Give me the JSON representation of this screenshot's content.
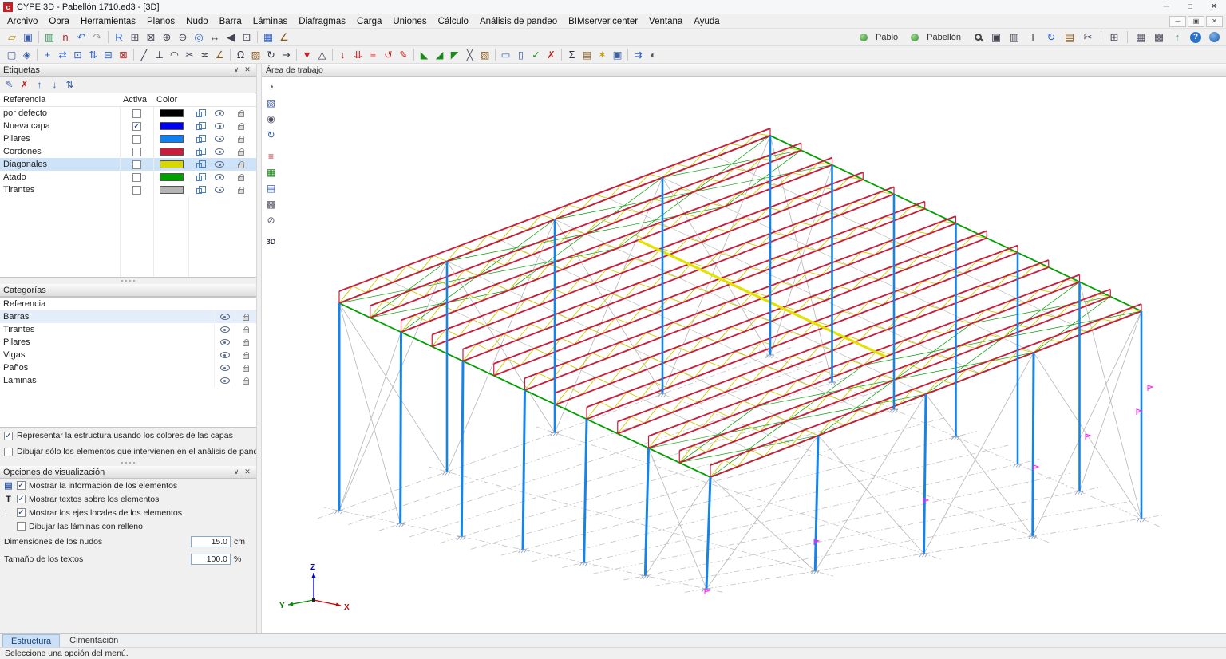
{
  "window": {
    "icon": "c",
    "title": "CYPE 3D - Pabellón 1710.ed3 - [3D]",
    "controls": [
      {
        "name": "minimize-button",
        "glyph": "─"
      },
      {
        "name": "maximize-button",
        "glyph": "□"
      },
      {
        "name": "close-button",
        "glyph": "✕"
      }
    ],
    "child_controls": [
      {
        "name": "child-minimize-button",
        "glyph": "─"
      },
      {
        "name": "child-restore-button",
        "glyph": "▣"
      },
      {
        "name": "child-close-button",
        "glyph": "✕"
      }
    ]
  },
  "menu": [
    "Archivo",
    "Obra",
    "Herramientas",
    "Planos",
    "Nudo",
    "Barra",
    "Láminas",
    "Diafragmas",
    "Carga",
    "Uniones",
    "Cálculo",
    "Análisis de pandeo",
    "BIMserver.center",
    "Ventana",
    "Ayuda"
  ],
  "toolbar_main": [
    {
      "name": "open-job-icon",
      "glyph": "▱",
      "color": "#c8940a"
    },
    {
      "name": "save-icon",
      "glyph": "▣",
      "color": "#3a5fa8"
    },
    {
      "sep": true
    },
    {
      "name": "resources-icon",
      "glyph": "▥",
      "color": "#2e8b57"
    },
    {
      "name": "cype-update-icon",
      "glyph": "n",
      "color": "#c32027"
    },
    {
      "name": "undo-icon",
      "glyph": "↶",
      "color": "#2a62c8"
    },
    {
      "name": "redo-icon",
      "glyph": "↷",
      "color": "#9a9a9a"
    },
    {
      "sep": true
    },
    {
      "name": "zoom-reference-icon",
      "glyph": "R",
      "color": "#2a62c8"
    },
    {
      "name": "zoom-extents-icon",
      "glyph": "⊞",
      "color": "#445"
    },
    {
      "name": "zoom-window-icon",
      "glyph": "⊠",
      "color": "#445"
    },
    {
      "name": "zoom-in-icon",
      "glyph": "⊕",
      "color": "#445"
    },
    {
      "name": "zoom-out-icon",
      "glyph": "⊖",
      "color": "#445"
    },
    {
      "name": "redraw-icon",
      "glyph": "◎",
      "color": "#2a62c8"
    },
    {
      "name": "pan-icon",
      "glyph": "↔",
      "color": "#445"
    },
    {
      "name": "previous-view-icon",
      "glyph": "◀",
      "color": "#445"
    },
    {
      "name": "full-view-icon",
      "glyph": "⊡",
      "color": "#445"
    },
    {
      "sep": true
    },
    {
      "name": "frame-view-icon",
      "glyph": "▦",
      "color": "#2a62c8"
    },
    {
      "name": "measure-icon",
      "glyph": "∠",
      "color": "#8a5a1a"
    }
  ],
  "toolbar_right": [
    {
      "name": "user-icon",
      "css": "userdot"
    },
    {
      "name": "user-name",
      "label": "Pablo"
    },
    {
      "name": "project-icon",
      "css": "userdot"
    },
    {
      "name": "project-name",
      "label": "Pabellón"
    },
    {
      "name": "search-icon",
      "css": "mag"
    },
    {
      "name": "window-manager-icon",
      "glyph": "▣",
      "color": "#445"
    },
    {
      "name": "views-icon",
      "glyph": "▥",
      "color": "#445"
    },
    {
      "name": "column-icon",
      "glyph": "I",
      "color": "#445"
    },
    {
      "name": "refresh-icon",
      "glyph": "↻",
      "color": "#2a62c8"
    },
    {
      "name": "report-icon",
      "glyph": "▤",
      "color": "#8a5a1a"
    },
    {
      "name": "tools-icon",
      "glyph": "✂",
      "color": "#445"
    },
    {
      "sep": true
    },
    {
      "name": "grid-icon",
      "glyph": "⊞",
      "color": "#445"
    },
    {
      "sep": true
    },
    {
      "name": "print-icon",
      "glyph": "▦",
      "color": "#556"
    },
    {
      "name": "layers-manager-icon",
      "glyph": "▩",
      "color": "#556"
    },
    {
      "name": "export-bim-icon",
      "glyph": "↑",
      "color": "#2e8b57"
    },
    {
      "name": "help-icon",
      "css": "helpbtn",
      "glyph": "?"
    },
    {
      "name": "web-icon",
      "css": "globe"
    }
  ],
  "toolbar_tools": [
    {
      "name": "job-window-icon",
      "glyph": "▢",
      "color": "#3a5fa8"
    },
    {
      "name": "workspace-icon",
      "glyph": "◈",
      "color": "#3a5fa8"
    },
    {
      "sep": true
    },
    {
      "name": "node-new-icon",
      "glyph": "+",
      "color": "#2a62c8"
    },
    {
      "name": "node-move-icon",
      "glyph": "⇄",
      "color": "#2a62c8"
    },
    {
      "name": "node-bind-icon",
      "glyph": "⊡",
      "color": "#2a62c8"
    },
    {
      "name": "node-align-icon",
      "glyph": "⇅",
      "color": "#2a62c8"
    },
    {
      "name": "node-mesh-icon",
      "glyph": "⊟",
      "color": "#2a62c8"
    },
    {
      "name": "node-delete-icon",
      "glyph": "⊠",
      "color": "#c02020"
    },
    {
      "sep": true
    },
    {
      "name": "bar-new-icon",
      "glyph": "╱",
      "color": "#334"
    },
    {
      "name": "bar-perpendicular-icon",
      "glyph": "⊥",
      "color": "#334"
    },
    {
      "name": "bar-arc-icon",
      "glyph": "◠",
      "color": "#334"
    },
    {
      "name": "bar-cut-icon",
      "glyph": "✂",
      "color": "#556"
    },
    {
      "name": "bar-join-icon",
      "glyph": "≍",
      "color": "#334"
    },
    {
      "name": "bar-angle-icon",
      "glyph": "∠",
      "color": "#8a5a1a"
    },
    {
      "sep": true
    },
    {
      "name": "describe-profile-icon",
      "glyph": "Ω",
      "color": "#334"
    },
    {
      "name": "describe-material-icon",
      "glyph": "▨",
      "color": "#8a5a1a"
    },
    {
      "name": "rotate-section-icon",
      "glyph": "↻",
      "color": "#334"
    },
    {
      "name": "offset-icon",
      "glyph": "↦",
      "color": "#334"
    },
    {
      "sep": true
    },
    {
      "name": "support-icon",
      "glyph": "▼",
      "color": "#c02020"
    },
    {
      "name": "hinge-icon",
      "glyph": "△",
      "color": "#334"
    },
    {
      "sep": true
    },
    {
      "name": "load-point-icon",
      "glyph": "↓",
      "color": "#c02020"
    },
    {
      "name": "load-line-icon",
      "glyph": "⇊",
      "color": "#c02020"
    },
    {
      "name": "load-surface-icon",
      "glyph": "≡",
      "color": "#c02020"
    },
    {
      "name": "load-moment-icon",
      "glyph": "↺",
      "color": "#c02020"
    },
    {
      "name": "load-edit-icon",
      "glyph": "✎",
      "color": "#c02020"
    },
    {
      "sep": true
    },
    {
      "name": "truss-type1-icon",
      "glyph": "◣",
      "color": "#1a8a1a"
    },
    {
      "name": "truss-type2-icon",
      "glyph": "◢",
      "color": "#1a8a1a"
    },
    {
      "name": "truss-type3-icon",
      "glyph": "◤",
      "color": "#1a8a1a"
    },
    {
      "name": "cross-brace-icon",
      "glyph": "╳",
      "color": "#556"
    },
    {
      "name": "paint-layer-icon",
      "glyph": "▧",
      "color": "#8a5a1a"
    },
    {
      "sep": true
    },
    {
      "name": "plate-icon",
      "glyph": "▭",
      "color": "#3a5fa8"
    },
    {
      "name": "shell-icon",
      "glyph": "▯",
      "color": "#3a5fa8"
    },
    {
      "name": "check-bars-icon",
      "glyph": "✓",
      "color": "#1a8a1a"
    },
    {
      "name": "errors-icon",
      "glyph": "✗",
      "color": "#c02020"
    },
    {
      "sep": true
    },
    {
      "name": "sum-icon",
      "glyph": "Σ",
      "color": "#334"
    },
    {
      "name": "results-icon",
      "glyph": "▤",
      "color": "#8a5a1a"
    },
    {
      "name": "tips-icon",
      "glyph": "✶",
      "color": "#c8a000"
    },
    {
      "name": "info-icon",
      "glyph": "▣",
      "color": "#3a5fa8"
    },
    {
      "sep": true
    },
    {
      "name": "flows-icon",
      "glyph": "⇉",
      "color": "#2a62c8"
    },
    {
      "name": "contrast-icon",
      "glyph": "◐",
      "color": "#556"
    }
  ],
  "etiquetas": {
    "title": "Etiquetas",
    "collapse_icon": "∨",
    "close_icon": "✕",
    "toolbar": [
      {
        "name": "edit-layers-icon",
        "glyph": "✎",
        "color": "#3a5fa8"
      },
      {
        "name": "delete-layer-icon",
        "glyph": "✗",
        "color": "#c02020"
      },
      {
        "name": "layer-up-icon",
        "glyph": "↑",
        "color": "#2a62c8"
      },
      {
        "name": "layer-down-icon",
        "glyph": "↓",
        "color": "#2a62c8"
      },
      {
        "name": "layer-order-icon",
        "glyph": "⇅",
        "color": "#3a5fa8"
      }
    ],
    "columns": [
      "Referencia",
      "Activa",
      "Color"
    ],
    "rows": [
      {
        "label": "por defecto",
        "checked": false,
        "color": "#000000",
        "selected": false
      },
      {
        "label": "Nueva capa",
        "checked": true,
        "color": "#0000f0",
        "selected": false
      },
      {
        "label": "Pilares",
        "checked": false,
        "color": "#1080f0",
        "selected": false
      },
      {
        "label": "Cordones",
        "checked": false,
        "color": "#c81e3c",
        "selected": false
      },
      {
        "label": "Diagonales",
        "checked": false,
        "color": "#d8d800",
        "selected": true
      },
      {
        "label": "Atado",
        "checked": false,
        "color": "#00a000",
        "selected": false
      },
      {
        "label": "Tirantes",
        "checked": false,
        "color": "#b4b4b4",
        "selected": false
      }
    ]
  },
  "categorias": {
    "title": "Categorías",
    "header": "Referencia",
    "rows": [
      {
        "label": "Barras",
        "selected": true
      },
      {
        "label": "Tirantes",
        "selected": false
      },
      {
        "label": "Pilares",
        "selected": false
      },
      {
        "label": "Vigas",
        "selected": false
      },
      {
        "label": "Paños",
        "selected": false
      },
      {
        "label": "Láminas",
        "selected": false
      }
    ]
  },
  "display_options": [
    {
      "label": "Representar la estructura usando los colores de las capas",
      "checked": true
    },
    {
      "label": "Dibujar sólo los elementos que intervienen en el análisis de pandeo",
      "checked": false
    }
  ],
  "visualizacion": {
    "title": "Opciones de visualización",
    "collapse_icon": "∨",
    "close_icon": "✕",
    "items": [
      {
        "label": "Mostrar la información de los elementos",
        "checked": true,
        "icon_name": "info-panel-icon",
        "icon_glyph": "▤",
        "icon_color": "#3a5fa8"
      },
      {
        "label": "Mostrar textos sobre los elementos",
        "checked": true,
        "icon_name": "text-icon",
        "icon_glyph": "T",
        "icon_color": "#223"
      },
      {
        "label": "Mostrar los ejes locales de los elementos",
        "checked": true,
        "icon_name": "local-axes-icon",
        "icon_glyph": "∟",
        "icon_color": "#223"
      },
      {
        "label": "Dibujar las láminas con relleno",
        "checked": false,
        "icon_name": "",
        "icon_glyph": "",
        "icon_color": ""
      }
    ],
    "fields": [
      {
        "label": "Dimensiones de los nudos",
        "value": "15.0",
        "unit": "cm",
        "name": "node-size"
      },
      {
        "label": "Tamaño de los textos",
        "value": "100.0",
        "unit": "%",
        "name": "text-size"
      }
    ]
  },
  "workspace_title": "Área de trabajo",
  "view_tools": [
    {
      "name": "protractor-icon",
      "glyph": "◔",
      "color": "#556"
    },
    {
      "name": "isometric-view-icon",
      "glyph": "▧",
      "color": "#3a5fa8"
    },
    {
      "name": "visibility-icon",
      "glyph": "◉",
      "color": "#556"
    },
    {
      "name": "orbit-icon",
      "glyph": "↻",
      "color": "#3a5fa8"
    },
    {
      "name": "layer-colors-icon",
      "glyph": "≡",
      "color": "#c02020",
      "gap": true
    },
    {
      "name": "mesh-icon",
      "glyph": "▦",
      "color": "#1a8a1a"
    },
    {
      "name": "table-icon",
      "glyph": "▤",
      "color": "#3a5fa8"
    },
    {
      "name": "layers-icon",
      "glyph": "▩",
      "color": "#556"
    },
    {
      "name": "hide-elements-icon",
      "glyph": "⊘",
      "color": "#556"
    },
    {
      "name": "view-3d-icon",
      "glyph": "3D",
      "color": "#334",
      "gap": true,
      "txt": true
    }
  ],
  "tabs": [
    {
      "label": "Estructura",
      "active": true
    },
    {
      "label": "Cimentación",
      "active": false
    }
  ],
  "status": "Seleccione una opción del menú.",
  "scene": {
    "colors": {
      "pillar": "#1583e8",
      "chord": "#c81e3c",
      "diagonal": "#cfcf00",
      "diagonal_selected": "#e2e200",
      "tie_green": "#00a000",
      "tie_gray": "#b9c0b9",
      "wall_brace": "#b6b6b6",
      "ground": "#c2c2c2",
      "support": "#8fa0b8",
      "node_flag": "#ff22ff"
    },
    "frames": 13,
    "axis": {
      "x": "X",
      "y": "Y",
      "z": "Z",
      "x_color": "#cc0000",
      "y_color": "#008800",
      "z_color": "#0000cc"
    }
  }
}
